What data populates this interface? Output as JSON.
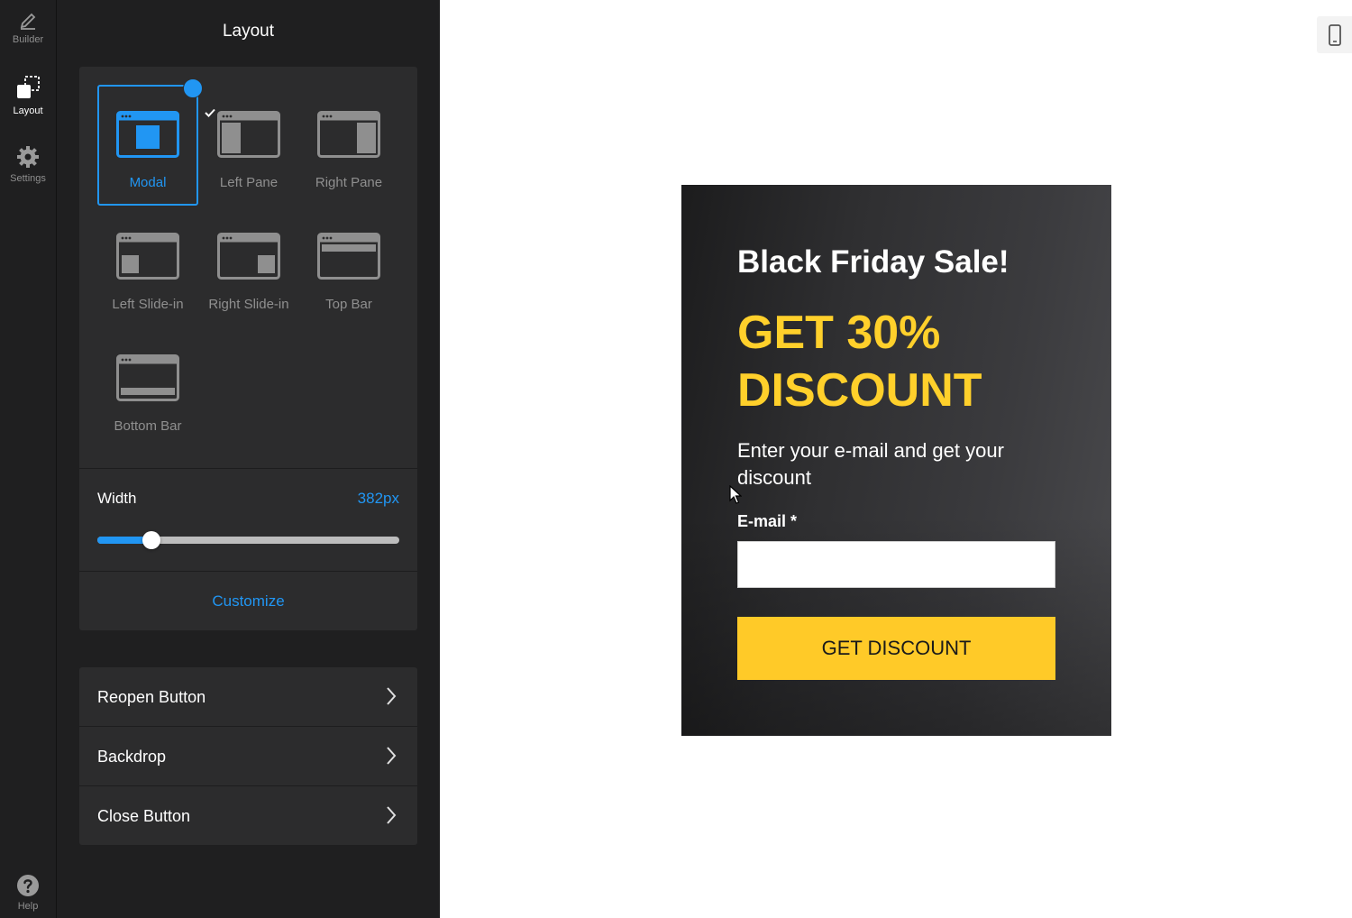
{
  "rail": {
    "items": [
      {
        "label": "Builder",
        "icon": "pencil-icon"
      },
      {
        "label": "Layout",
        "icon": "layout-icon"
      },
      {
        "label": "Settings",
        "icon": "gear-icon"
      }
    ],
    "help": {
      "label": "Help",
      "icon": "help-icon"
    }
  },
  "panel": {
    "title": "Layout",
    "layout_options": [
      {
        "label": "Modal",
        "selected": true
      },
      {
        "label": "Left Pane",
        "selected": false
      },
      {
        "label": "Right Pane",
        "selected": false
      },
      {
        "label": "Left Slide-in",
        "selected": false
      },
      {
        "label": "Right Slide-in",
        "selected": false
      },
      {
        "label": "Top Bar",
        "selected": false
      },
      {
        "label": "Bottom Bar",
        "selected": false
      }
    ],
    "width": {
      "label": "Width",
      "value": "382px",
      "slider_fraction": 0.18
    },
    "customize_label": "Customize",
    "sections": [
      {
        "label": "Reopen Button"
      },
      {
        "label": "Backdrop"
      },
      {
        "label": "Close Button"
      }
    ]
  },
  "preview": {
    "device_toggle_icon": "mobile-device-icon",
    "popup": {
      "title": "Black Friday Sale!",
      "headline": "GET 30% DISCOUNT",
      "text": "Enter your e-mail and get your discount",
      "field_label": "E-mail *",
      "field_value": "",
      "button_label": "GET DISCOUNT"
    }
  },
  "colors": {
    "accent": "#2196f3",
    "popup_highlight": "#ffd02b",
    "popup_button": "#ffca28",
    "sidebar_bg": "#1f1f20",
    "card_bg": "#2c2c2d"
  }
}
